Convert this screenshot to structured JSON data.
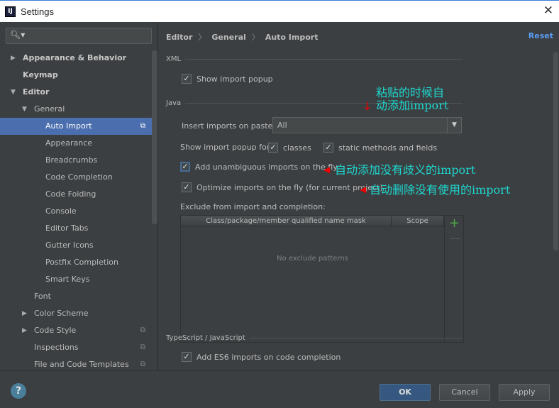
{
  "window": {
    "title": "Settings",
    "app_icon": "IJ"
  },
  "sidebar": {
    "items": [
      {
        "label": "Appearance & Behavior",
        "level": 0,
        "arrow": "right",
        "bold": true
      },
      {
        "label": "Keymap",
        "level": 0,
        "bold": true
      },
      {
        "label": "Editor",
        "level": 0,
        "arrow": "down",
        "bold": true
      },
      {
        "label": "General",
        "level": 1,
        "arrow": "down"
      },
      {
        "label": "Auto Import",
        "level": 2,
        "selected": true,
        "project_icon": true
      },
      {
        "label": "Appearance",
        "level": 2
      },
      {
        "label": "Breadcrumbs",
        "level": 2
      },
      {
        "label": "Code Completion",
        "level": 2
      },
      {
        "label": "Code Folding",
        "level": 2
      },
      {
        "label": "Console",
        "level": 2
      },
      {
        "label": "Editor Tabs",
        "level": 2
      },
      {
        "label": "Gutter Icons",
        "level": 2
      },
      {
        "label": "Postfix Completion",
        "level": 2
      },
      {
        "label": "Smart Keys",
        "level": 2
      },
      {
        "label": "Font",
        "level": 1
      },
      {
        "label": "Color Scheme",
        "level": 1,
        "arrow": "right"
      },
      {
        "label": "Code Style",
        "level": 1,
        "arrow": "right",
        "project_icon": true
      },
      {
        "label": "Inspections",
        "level": 1,
        "project_icon": true
      },
      {
        "label": "File and Code Templates",
        "level": 1,
        "project_icon": true
      }
    ]
  },
  "main": {
    "breadcrumb": [
      "Editor",
      "General",
      "Auto Import"
    ],
    "reset": "Reset",
    "xml_section": "XML",
    "xml_show_popup": "Show import popup",
    "java_section": "Java",
    "insert_label": "Insert imports on paste:",
    "insert_value": "All",
    "popup_for_label": "Show import popup for:",
    "classes": "classes",
    "static": "static methods and fields",
    "add_unambiguous": "Add unambiguous imports on the fly",
    "optimize": "Optimize imports on the fly (for current project)",
    "exclude_label": "Exclude from import and completion:",
    "col_mask": "Class/package/member qualified name mask",
    "col_scope": "Scope",
    "empty": "No exclude patterns",
    "ts_section": "TypeScript / JavaScript",
    "es6": "Add ES6 imports on code completion"
  },
  "annotations": {
    "paste_line1": "粘贴的时候自",
    "paste_line2": "动添加import",
    "unambiguous": "自动添加没有歧义的import",
    "optimize": "自动删除没有使用的import"
  },
  "footer": {
    "ok": "OK",
    "cancel": "Cancel",
    "apply": "Apply",
    "help": "?"
  },
  "colors": {
    "selection": "#4b6eaf",
    "accent": "#589df6",
    "annotation": "#1dd7d0",
    "arrow": "#ee0000"
  }
}
